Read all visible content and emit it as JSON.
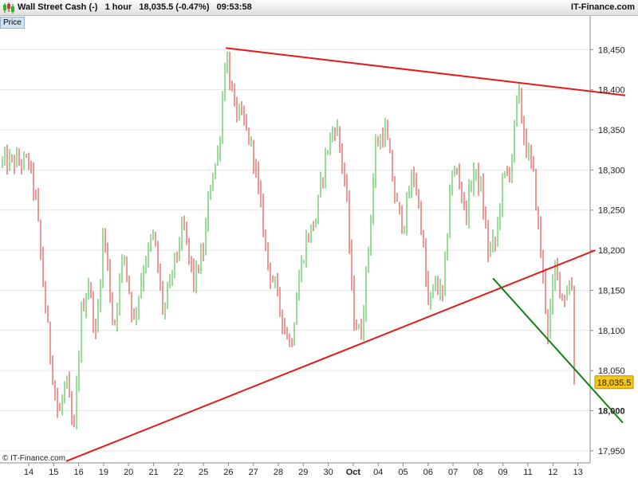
{
  "header": {
    "instrument": "Wall Street Cash (-)",
    "timeframe": "1 hour",
    "quote": "18,035.5 (-0.47%)",
    "time": "09:53:58",
    "brand": "IT-Finance.com",
    "logo_icon": "candlestick-logo-icon"
  },
  "price_tag": "Price",
  "copyright": "© IT-Finance.com",
  "colors": {
    "up": "#33bb33",
    "down": "#dd3333",
    "trendline": "#e21b1b",
    "support_green": "#128012",
    "grid": "#e4e4e4",
    "last_price_bg": "#f5c518"
  },
  "chart_data": {
    "type": "candlestick",
    "title": "Wall Street Cash (-) 1 hour",
    "ylim": [
      17935,
      18490
    ],
    "y_ticks": [
      17950,
      18000,
      18050,
      18100,
      18150,
      18200,
      18250,
      18300,
      18350,
      18400,
      18450
    ],
    "y_tick_labels": [
      "17,950",
      "18,000",
      "18,050",
      "18,100",
      "18,150",
      "18,200",
      "18,250",
      "18,300",
      "18,350",
      "18,400",
      "18,450"
    ],
    "x_ticks": [
      "14",
      "15",
      "16",
      "19",
      "20",
      "21",
      "22",
      "25",
      "26",
      "27",
      "28",
      "29",
      "30",
      "Oct",
      "04",
      "05",
      "06",
      "07",
      "08",
      "09",
      "11",
      "12",
      "13"
    ],
    "last_price": "18,035.5",
    "last_price_value": 18035.5,
    "price_path": [
      [
        0,
        18310
      ],
      [
        0.3,
        18260
      ],
      [
        0.6,
        18150
      ],
      [
        0.9,
        18060
      ],
      [
        1.2,
        17990
      ],
      [
        1.5,
        18040
      ],
      [
        1.8,
        17965
      ],
      [
        2.1,
        18120
      ],
      [
        2.4,
        18160
      ],
      [
        2.7,
        18090
      ],
      [
        3,
        18230
      ],
      [
        3.4,
        18100
      ],
      [
        3.8,
        18200
      ],
      [
        4.2,
        18110
      ],
      [
        4.6,
        18180
      ],
      [
        5,
        18220
      ],
      [
        5.4,
        18120
      ],
      [
        5.8,
        18180
      ],
      [
        6.2,
        18230
      ],
      [
        6.6,
        18160
      ],
      [
        7,
        18200
      ],
      [
        7.3,
        18290
      ],
      [
        7.6,
        18320
      ],
      [
        7.9,
        18450
      ],
      [
        8.2,
        18380
      ],
      [
        8.6,
        18360
      ],
      [
        9,
        18320
      ],
      [
        9.3,
        18250
      ],
      [
        9.6,
        18180
      ],
      [
        9.9,
        18150
      ],
      [
        10.2,
        18110
      ],
      [
        10.5,
        18080
      ],
      [
        10.8,
        18160
      ],
      [
        11.1,
        18210
      ],
      [
        11.5,
        18240
      ],
      [
        11.9,
        18320
      ],
      [
        12.3,
        18360
      ],
      [
        12.7,
        18280
      ],
      [
        13,
        18120
      ],
      [
        13.3,
        18090
      ],
      [
        13.6,
        18200
      ],
      [
        13.9,
        18330
      ],
      [
        14.3,
        18350
      ],
      [
        14.7,
        18260
      ],
      [
        15,
        18230
      ],
      [
        15.4,
        18300
      ],
      [
        15.7,
        18240
      ],
      [
        16,
        18130
      ],
      [
        16.3,
        18160
      ],
      [
        16.6,
        18140
      ],
      [
        16.9,
        18290
      ],
      [
        17.2,
        18300
      ],
      [
        17.5,
        18240
      ],
      [
        17.8,
        18300
      ],
      [
        18.1,
        18280
      ],
      [
        18.4,
        18200
      ],
      [
        18.7,
        18210
      ],
      [
        19,
        18290
      ],
      [
        19.3,
        18300
      ],
      [
        19.6,
        18400
      ],
      [
        19.9,
        18330
      ],
      [
        20.2,
        18300
      ],
      [
        20.5,
        18200
      ],
      [
        20.8,
        18100
      ],
      [
        21.1,
        18180
      ],
      [
        21.4,
        18140
      ],
      [
        21.7,
        18160
      ],
      [
        22,
        18120
      ],
      [
        22.3,
        18150
      ],
      [
        22.6,
        18080
      ],
      [
        22.9,
        18020
      ],
      [
        23.1,
        18035.5
      ]
    ],
    "trendlines": [
      {
        "color": "red",
        "from": [
          7.9,
          18452
        ],
        "to": [
          23.9,
          18393
        ]
      },
      {
        "color": "red",
        "from": [
          1.5,
          17937
        ],
        "to": [
          22.7,
          18200
        ]
      },
      {
        "color": "green",
        "from": [
          18.6,
          18165
        ],
        "to": [
          23.8,
          17985
        ]
      }
    ],
    "grid": true,
    "y_axis_position": "right"
  }
}
